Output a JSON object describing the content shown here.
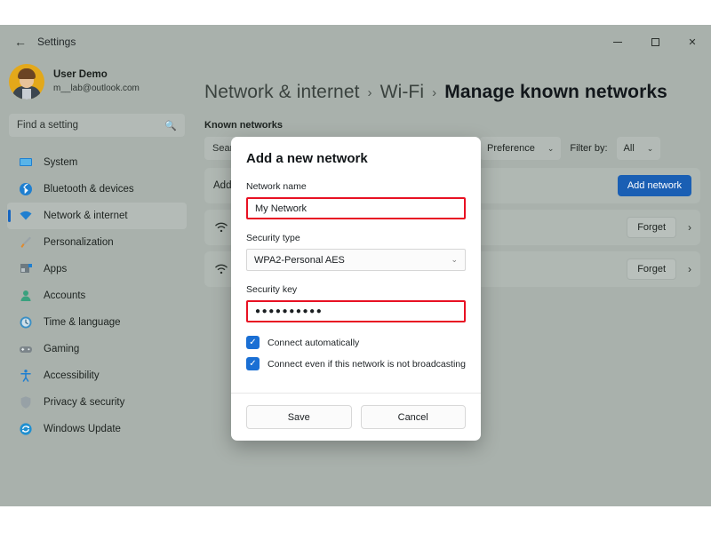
{
  "titlebar": {
    "back_icon": "back-arrow-icon",
    "title": "Settings",
    "minimize": "–",
    "maximize": "",
    "close": "×"
  },
  "sidebar": {
    "account": {
      "name": "User Demo",
      "email": "m__lab@outlook.com",
      "avatar": "user-avatar"
    },
    "search": {
      "placeholder": "Find a setting",
      "icon": "search-icon"
    },
    "items": [
      {
        "label": "System",
        "icon": "monitor-icon",
        "active": false
      },
      {
        "label": "Bluetooth & devices",
        "icon": "bluetooth-icon",
        "active": false
      },
      {
        "label": "Network & internet",
        "icon": "wifi-icon",
        "active": true
      },
      {
        "label": "Personalization",
        "icon": "paintbrush-icon",
        "active": false
      },
      {
        "label": "Apps",
        "icon": "apps-icon",
        "active": false
      },
      {
        "label": "Accounts",
        "icon": "person-icon",
        "active": false
      },
      {
        "label": "Time & language",
        "icon": "clock-icon",
        "active": false
      },
      {
        "label": "Gaming",
        "icon": "gamepad-icon",
        "active": false
      },
      {
        "label": "Accessibility",
        "icon": "accessibility-icon",
        "active": false
      },
      {
        "label": "Privacy & security",
        "icon": "shield-icon",
        "active": false
      },
      {
        "label": "Windows Update",
        "icon": "update-icon",
        "active": false
      }
    ]
  },
  "main": {
    "breadcrumb": {
      "first": "Network & internet",
      "separator1": "›",
      "second": "Wi-Fi",
      "separator2": "›",
      "current": "Manage known networks"
    },
    "section_title": "Known networks",
    "toolbar": {
      "search_placeholder": "Search the list of networks",
      "preference_label": "Preference",
      "preference_chevron": "⌄",
      "filter_label": "Filter by:",
      "filter_value": "All",
      "filter_chevron": "⌄"
    },
    "add_row": {
      "label": "Add a new network",
      "button": "Add network"
    },
    "networks": [
      {
        "icon": "wifi-icon",
        "forget": "Forget",
        "chevron": "›"
      },
      {
        "icon": "wifi-icon",
        "forget": "Forget",
        "chevron": "›"
      }
    ]
  },
  "dialog": {
    "title": "Add a new network",
    "network_name": {
      "label": "Network name",
      "value": "My Network",
      "highlighted": true
    },
    "security_type": {
      "label": "Security type",
      "value": "WPA2-Personal AES",
      "chevron": "⌄"
    },
    "security_key": {
      "label": "Security key",
      "value": "●●●●●●●●●●",
      "highlighted": true
    },
    "checkboxes": [
      {
        "label": "Connect automatically",
        "checked": true,
        "mark": "✓"
      },
      {
        "label": "Connect even if this network is not broadcasting",
        "checked": true,
        "mark": "✓"
      }
    ],
    "save_label": "Save",
    "cancel_label": "Cancel"
  },
  "colors": {
    "window_bg": "#a9b1ac",
    "accent_blue": "#1a5fb4",
    "highlight_red": "#e81123",
    "checkbox_blue": "#1a6fd4"
  }
}
